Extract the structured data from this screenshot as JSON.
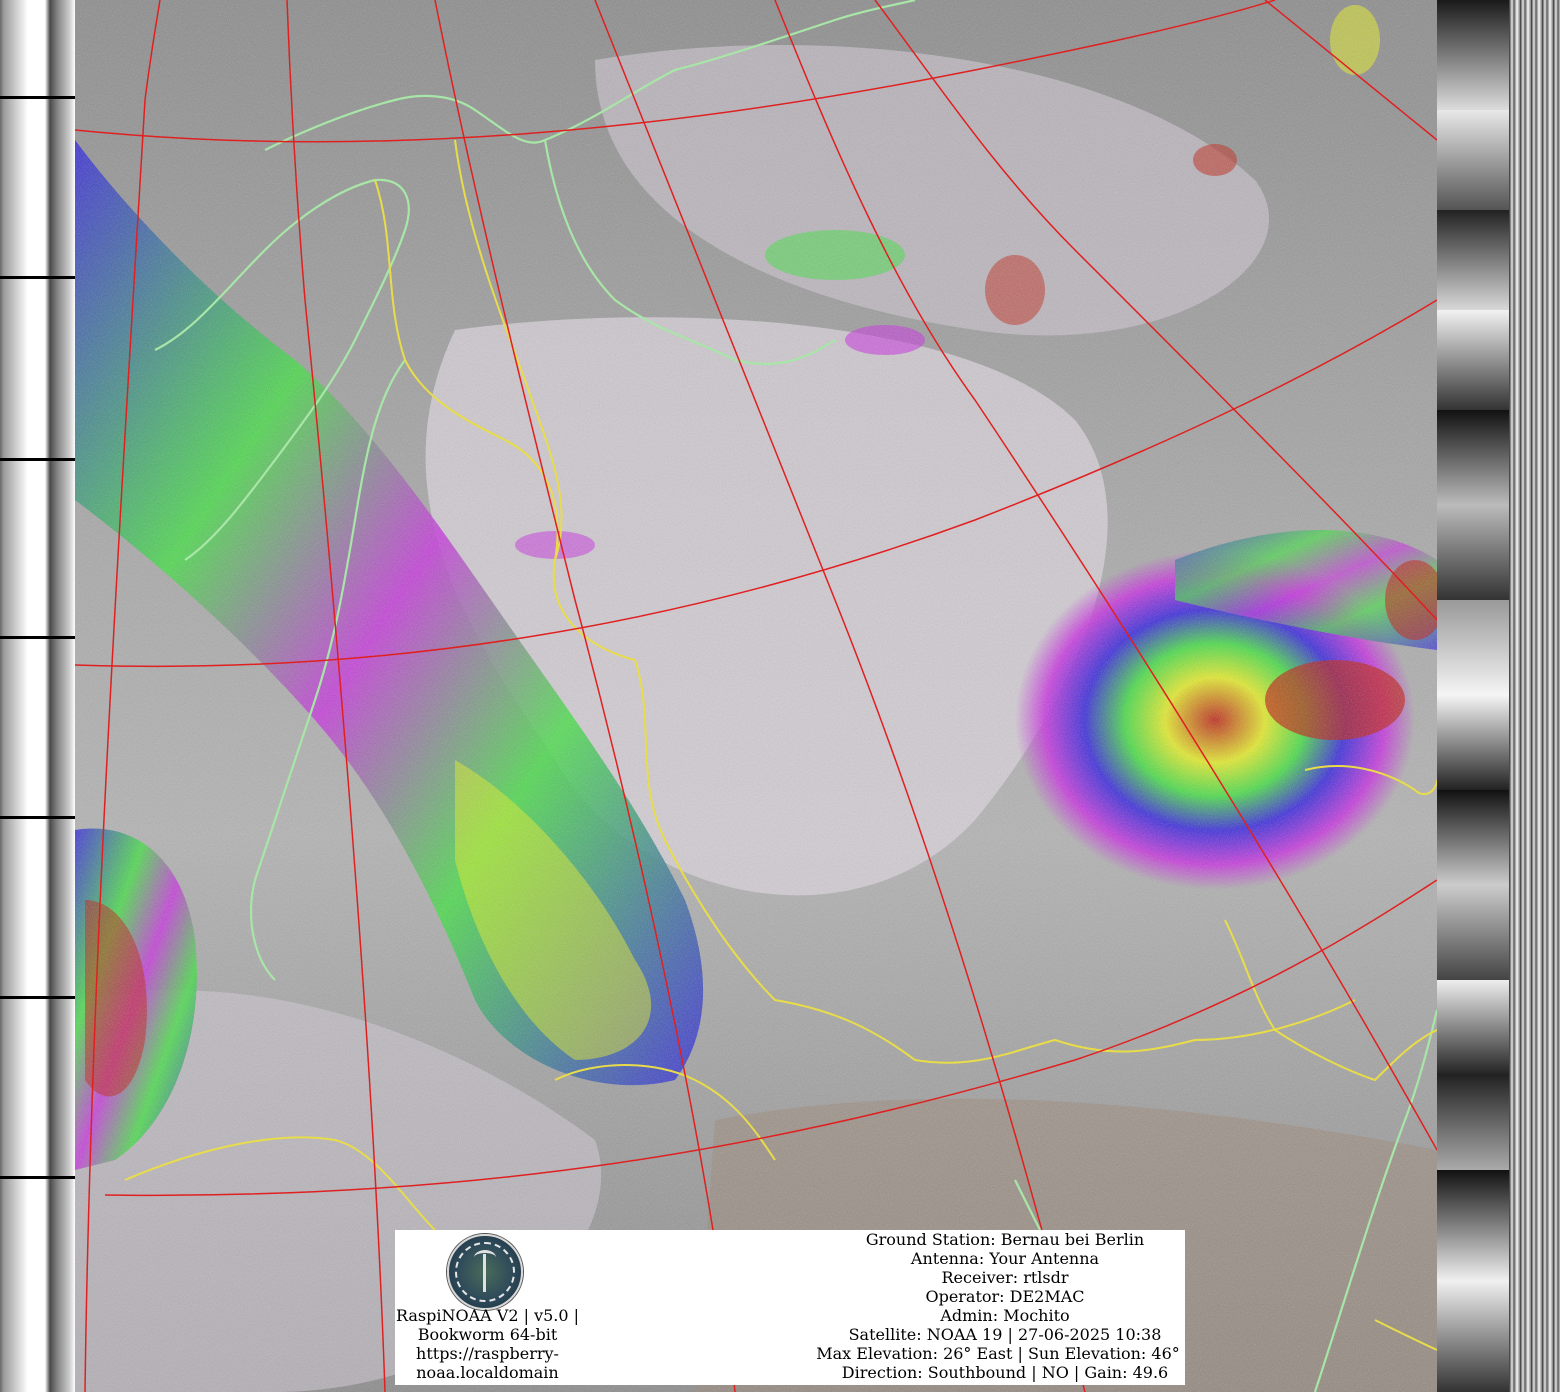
{
  "caption": {
    "logo_icon": "satellite-ground-station-seal",
    "left": {
      "line1": "RaspiNOAA V2 | v5.0 |",
      "line2": "Bookworm 64-bit",
      "line3": "https://raspberry-",
      "line4": "noaa.localdomain"
    },
    "right": {
      "ground_station": "Ground Station: Bernau bei Berlin",
      "antenna": "Antenna: Your Antenna",
      "receiver": "Receiver: rtlsdr",
      "operator": "Operator: DE2MAC",
      "admin": "Admin: Mochito",
      "satellite": "Satellite: NOAA 19 | 27-06-2025 10:38",
      "elevation": "Max Elevation: 26° East | Sun Elevation: 46°",
      "direction": "Direction: Southbound | NO | Gain: 49.6"
    }
  },
  "colors": {
    "graticule": "#e02020",
    "borders": "#e8dc4a",
    "coastline": "#a8e6a8",
    "cloud_gray": "#b5b5b5",
    "enhancement_magenta": "#c830e0",
    "enhancement_blue": "#3020e0",
    "enhancement_green": "#40e040",
    "enhancement_yellow": "#e8f020",
    "enhancement_red": "#c02010"
  }
}
